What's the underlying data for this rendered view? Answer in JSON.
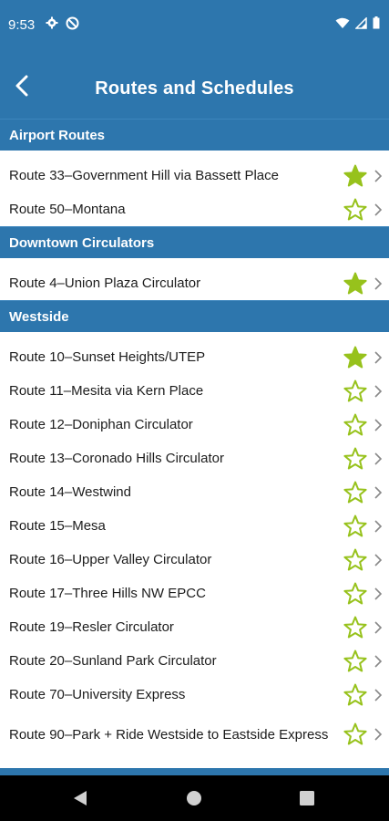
{
  "status_bar": {
    "time": "9:53",
    "icons": [
      "gear-icon",
      "no-sync-icon",
      "wifi-icon",
      "signal-icon",
      "battery-icon"
    ]
  },
  "app_bar": {
    "title": "Routes and Schedules",
    "back_icon": "chevron-left-icon"
  },
  "colors": {
    "primary": "#2d76ad",
    "star": "#97c21c"
  },
  "sections": [
    {
      "title": "Airport Routes",
      "routes": [
        {
          "label": "Route 33–Government Hill via Bassett Place",
          "favorite": true
        },
        {
          "label": "Route 50–Montana",
          "favorite": false
        }
      ]
    },
    {
      "title": "Downtown Circulators",
      "routes": [
        {
          "label": "Route 4–Union Plaza Circulator",
          "favorite": true
        }
      ]
    },
    {
      "title": "Westside",
      "routes": [
        {
          "label": "Route 10–Sunset Heights/UTEP",
          "favorite": true
        },
        {
          "label": "Route 11–Mesita via Kern Place",
          "favorite": false
        },
        {
          "label": "Route 12–Doniphan Circulator",
          "favorite": false
        },
        {
          "label": "Route 13–Coronado Hills Circulator",
          "favorite": false
        },
        {
          "label": "Route 14–Westwind",
          "favorite": false
        },
        {
          "label": "Route 15–Mesa",
          "favorite": false
        },
        {
          "label": "Route 16–Upper Valley Circulator",
          "favorite": false
        },
        {
          "label": "Route 17–Three Hills NW EPCC",
          "favorite": false
        },
        {
          "label": "Route 19–Resler Circulator",
          "favorite": false
        },
        {
          "label": "Route 20–Sunland Park Circulator",
          "favorite": false
        },
        {
          "label": "Route 70–University Express",
          "favorite": false
        },
        {
          "label": "Route 90–Park + Ride Westside to Eastside Express",
          "favorite": false
        }
      ]
    }
  ]
}
